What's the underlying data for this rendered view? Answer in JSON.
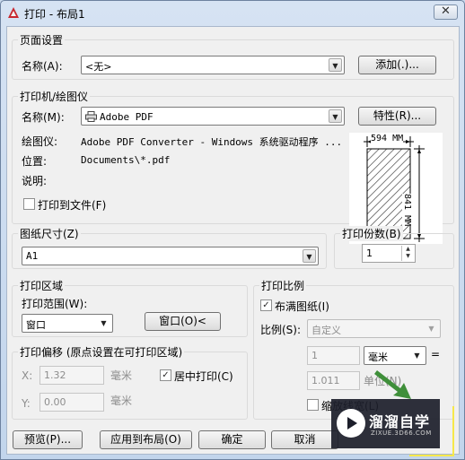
{
  "window": {
    "title": "打印 - 布局1",
    "close_label": "✕"
  },
  "page_setup": {
    "group_title": "页面设置",
    "name_label": "名称(A):",
    "name_value": "<无>",
    "add_button": "添加(.)..."
  },
  "printer": {
    "group_title": "打印机/绘图仪",
    "name_label": "名称(M):",
    "name_value": "Adobe PDF",
    "properties_button": "特性(R)...",
    "plotter_label": "绘图仪:",
    "plotter_value": "Adobe PDF Converter - Windows 系统驱动程序 ...",
    "location_label": "位置:",
    "location_value": "Documents\\*.pdf",
    "description_label": "说明:",
    "print_to_file_label": "打印到文件(F)",
    "print_to_file_checked": false,
    "preview_width_label": "594 MM",
    "preview_height_label": "841 MM"
  },
  "paper_size": {
    "group_title": "图纸尺寸(Z)",
    "value": "A1"
  },
  "copies": {
    "group_title": "打印份数(B)",
    "value": "1"
  },
  "plot_area": {
    "group_title": "打印区域",
    "range_label": "打印范围(W):",
    "range_value": "窗口",
    "window_button": "窗口(O)<"
  },
  "plot_offset": {
    "group_title": "打印偏移 (原点设置在可打印区域)",
    "x_label": "X:",
    "x_value": "1.32",
    "x_unit": "毫米",
    "y_label": "Y:",
    "y_value": "0.00",
    "y_unit": "毫米",
    "center_label": "居中打印(C)",
    "center_checked": true
  },
  "plot_scale": {
    "group_title": "打印比例",
    "fit_label": "布满图纸(I)",
    "fit_checked": true,
    "scale_label": "比例(S):",
    "scale_value": "自定义",
    "value1": "1",
    "unit_value": "毫米",
    "equals": "=",
    "value2": "1.011",
    "unit_label": "单位(N)",
    "lineweight_label": "缩放线宽(L)",
    "lineweight_checked": false
  },
  "footer": {
    "preview_button": "预览(P)...",
    "apply_button": "应用到布局(O)",
    "ok_button": "确定",
    "cancel_button": "取消"
  },
  "watermark": {
    "title": "溜溜自学",
    "subtitle": "ZIXUE.3D66.COM"
  },
  "colors": {
    "accent_green": "#3f8f3a",
    "highlight_yellow": "#f6e84a",
    "title_icon_red": "#c8262e"
  }
}
